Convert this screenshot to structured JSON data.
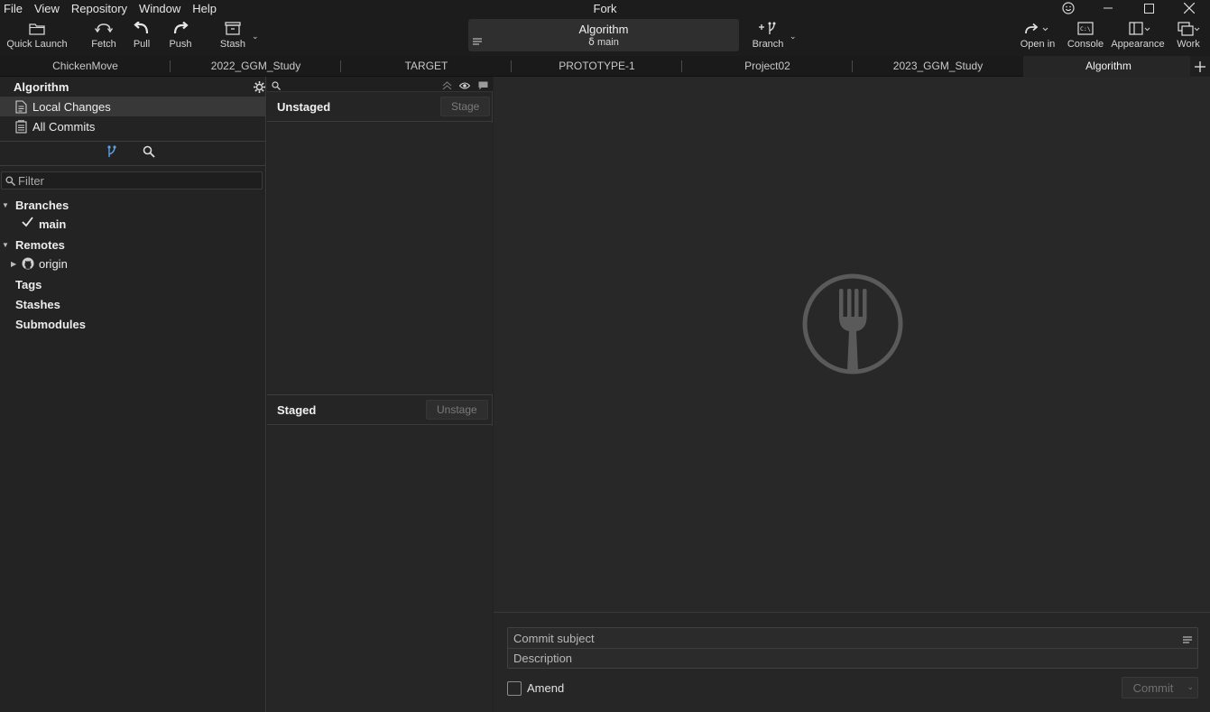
{
  "app": {
    "title": "Fork"
  },
  "menu": [
    "File",
    "View",
    "Repository",
    "Window",
    "Help"
  ],
  "toolbar": {
    "quick_launch": "Quick Launch",
    "fetch": "Fetch",
    "pull": "Pull",
    "push": "Push",
    "stash": "Stash",
    "branch": "Branch",
    "open_in": "Open in",
    "console": "Console",
    "appearance": "Appearance",
    "work": "Work"
  },
  "repo": {
    "name": "Algorithm",
    "branch": "main"
  },
  "tabs": [
    "ChickenMove",
    "2022_GGM_Study",
    "TARGET",
    "PROTOTYPE-1",
    "Project02",
    "2023_GGM_Study",
    "Algorithm"
  ],
  "active_tab": "Algorithm",
  "sidebar": {
    "title": "Algorithm",
    "local_changes": "Local Changes",
    "all_commits": "All Commits",
    "filter_placeholder": "Filter",
    "branches": "Branches",
    "current_branch": "main",
    "remotes": "Remotes",
    "origin": "origin",
    "tags": "Tags",
    "stashes": "Stashes",
    "submodules": "Submodules"
  },
  "changes": {
    "unstaged_title": "Unstaged",
    "stage_button": "Stage",
    "staged_title": "Staged",
    "unstage_button": "Unstage"
  },
  "commit": {
    "subject_placeholder": "Commit subject",
    "description_placeholder": "Description",
    "amend_label": "Amend",
    "commit_button": "Commit"
  },
  "colors": {
    "background": "#222222",
    "selected_row": "#383838",
    "accent_blue": "#5aa0e6",
    "logo_gray": "#5a5a5a"
  }
}
